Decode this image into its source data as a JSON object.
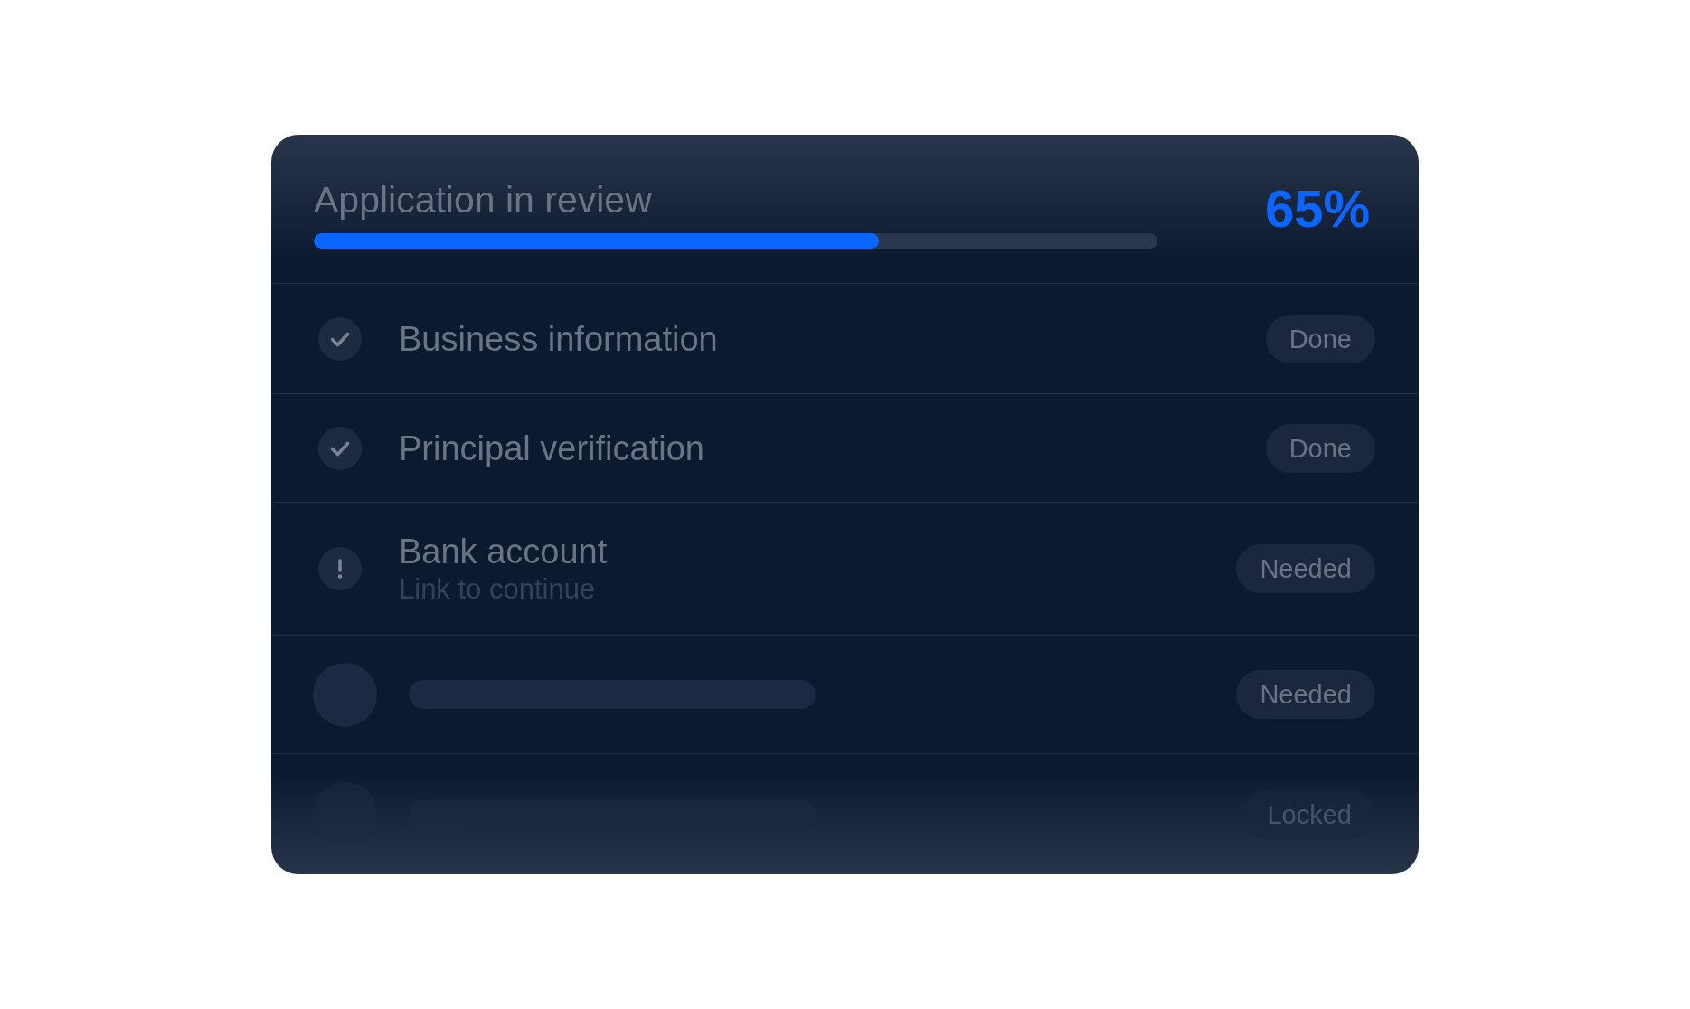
{
  "header": {
    "title": "Application in review",
    "percent": "65%",
    "progress": {
      "level": 0.67
    }
  },
  "steps": [
    {
      "kind": "complete",
      "label": "Business information",
      "status": "Done",
      "faded": false
    },
    {
      "kind": "complete",
      "label": "Principal verification",
      "status": "Done",
      "faded": false
    },
    {
      "kind": "attention",
      "label": "Bank account",
      "sublabel": "Link to continue",
      "status": "Needed",
      "faded": false
    },
    {
      "kind": "placeholder",
      "status": "Needed",
      "faded": false
    },
    {
      "kind": "placeholder",
      "status": "Locked",
      "faded": true
    }
  ]
}
